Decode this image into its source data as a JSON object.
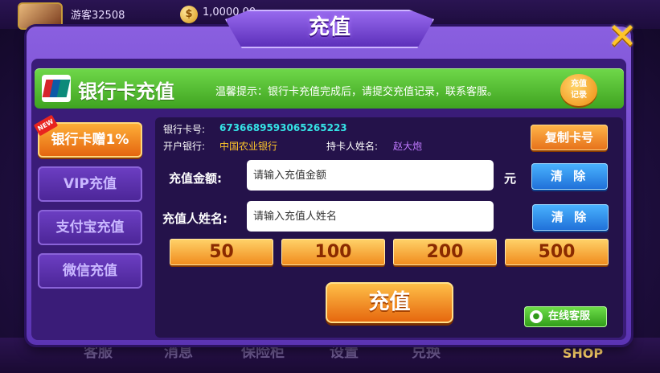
{
  "background": {
    "username": "游客32508",
    "coin_icon": "$",
    "balance": "1,0000.00",
    "nav": [
      "客服",
      "消息",
      "保险柜",
      "设置",
      "兑换"
    ],
    "shop_label": "SHOP"
  },
  "modal": {
    "title": "充值",
    "close_icon": "✕"
  },
  "header": {
    "title": "银行卡充值",
    "tip": "温馨提示：银行卡充值完成后，请提交充值记录，联系客服。",
    "record_button": "充值\n记录"
  },
  "tabs": [
    {
      "label": "银行卡赠1%",
      "active": true,
      "badge": "NEW"
    },
    {
      "label": "VIP充值",
      "active": false
    },
    {
      "label": "支付宝充值",
      "active": false
    },
    {
      "label": "微信充值",
      "active": false
    }
  ],
  "bank": {
    "card_label": "银行卡号:",
    "card_number": "6736689593065265223",
    "bank_label": "开户银行:",
    "bank_name": "中国农业银行",
    "holder_label": "持卡人姓名:",
    "holder_name": "赵大炮",
    "copy_button": "复制卡号"
  },
  "form": {
    "amount_label": "充值金额:",
    "amount_placeholder": "请输入充值金额",
    "unit": "元",
    "clear_label": "清 除",
    "name_label": "充值人姓名:",
    "name_placeholder": "请输入充值人姓名"
  },
  "quick_amounts": [
    "50",
    "100",
    "200",
    "500"
  ],
  "submit_button": "充值",
  "service_button": "在线客服",
  "colors": {
    "accent_orange": "#e6701a",
    "header_green": "#3fa320",
    "panel_purple": "#24124a",
    "card_cyan": "#35e3e6"
  }
}
